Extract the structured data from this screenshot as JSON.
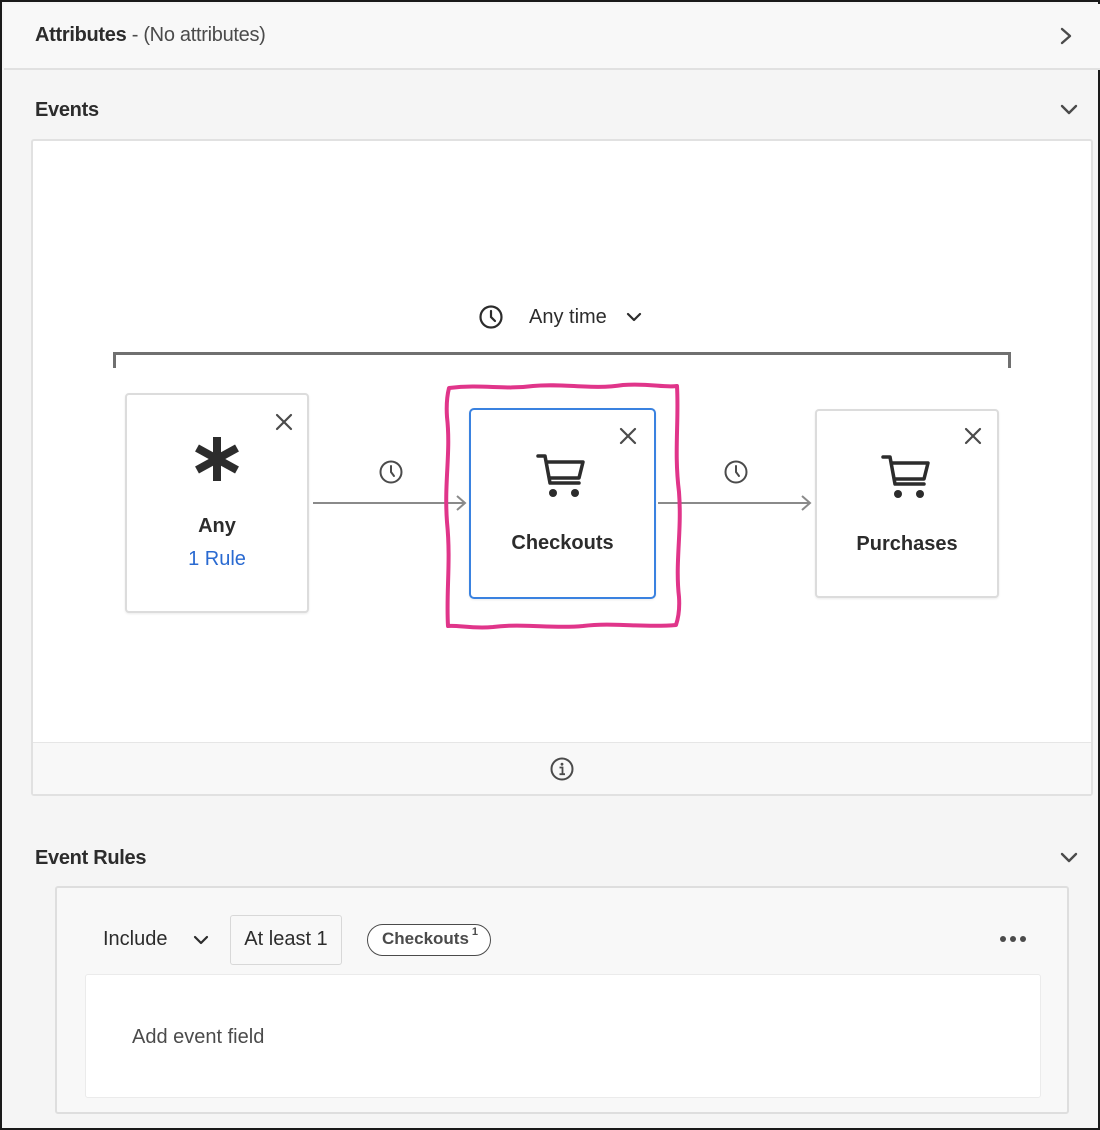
{
  "attributes": {
    "title": "Attributes",
    "summary": " - (No attributes)"
  },
  "events": {
    "title": "Events",
    "time_window": "Any time",
    "steps": [
      {
        "label": "Any",
        "sublabel": "1 Rule",
        "icon": "asterisk-icon"
      },
      {
        "label": "Checkouts",
        "icon": "shopping-cart-icon",
        "selected": true
      },
      {
        "label": "Purchases",
        "icon": "shopping-cart-icon"
      }
    ]
  },
  "event_rules": {
    "title": "Event Rules",
    "include_label": "Include",
    "count_label": "At least 1",
    "tag_label": "Checkouts",
    "tag_count": "1",
    "field_placeholder": "Add event field"
  },
  "colors": {
    "selected_border": "#3a82e0",
    "link": "#2a6ad1",
    "highlight": "#e0358a"
  }
}
